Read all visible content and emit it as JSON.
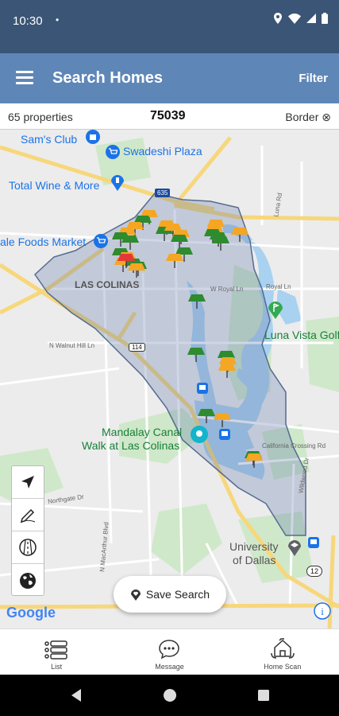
{
  "status": {
    "time": "10:30",
    "dot": "•"
  },
  "appbar": {
    "title": "Search Homes",
    "filter_label": "Filter"
  },
  "infobar": {
    "count": "65 properties",
    "zip": "75039",
    "border_label": "Border ⊗"
  },
  "map": {
    "labels": {
      "sams_club": "Sam's Club",
      "swadeshi": "Swadeshi Plaza",
      "total_wine": "Total Wine & More",
      "foods_market": "ale Foods Market",
      "las_colinas": "LAS COLINAS",
      "luna_vista": "Luna Vista Golf",
      "mandalay_1": "Mandalay Canal",
      "mandalay_2": "Walk at Las Colinas",
      "univ_1": "University",
      "univ_2": "of Dallas",
      "hwy_635": "635",
      "hwy_114": "114",
      "hwy_12": "12",
      "royal_ln": "Royal Ln",
      "w_royal_ln": "W Royal Ln",
      "n_walnut_hill": "N Walnut Hill Ln",
      "california": "California Crossing Rd",
      "luna_rd": "Luna Rd",
      "wildwood": "Wildwood Dr",
      "n_macarthur": "N MacArthur Blvd",
      "northgate": "Northgate Dr"
    },
    "google_logo": "Google"
  },
  "save_search_label": "Save Search",
  "bottom_nav": {
    "list": "List",
    "message": "Message",
    "home_scan": "Home Scan"
  },
  "colors": {
    "pin_green": "#2e8b2e",
    "pin_orange": "#f5a623",
    "appbar": "#5e87b8",
    "status": "#3a5575"
  }
}
